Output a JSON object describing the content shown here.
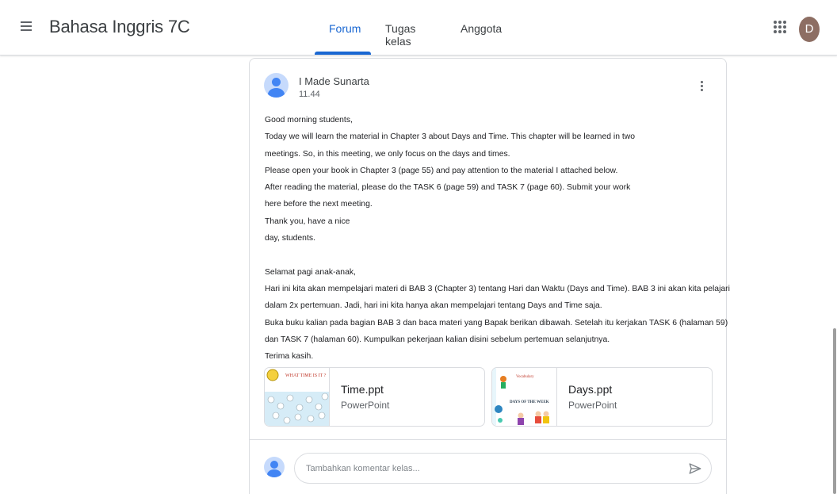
{
  "header": {
    "class_title": "Bahasa Inggris 7C",
    "tabs": [
      {
        "label": "Forum",
        "active": true
      },
      {
        "label": "Tugas kelas",
        "active": false
      },
      {
        "label": "Anggota",
        "active": false
      }
    ],
    "user_initial": "D",
    "accent_color": "#1967d2",
    "avatar_color": "#8d6e63",
    "icons": [
      "menu-icon",
      "apps-grid-icon"
    ]
  },
  "post": {
    "author": "I Made Sunarta",
    "time": "11.44",
    "lines": [
      "Good morning students,",
      "Today we will learn the material in Chapter 3 about Days and Time. This chapter will be learned in two",
      "meetings. So, in this meeting, we only focus on the days and times.",
      "Please open your book in Chapter 3 (page 55) and pay attention to the material I attached below.",
      "After reading the material, please do the TASK 6 (page 59) and TASK 7 (page 60). Submit your work",
      "here before the next meeting.",
      "Thank you, have a nice",
      "day, students.",
      "",
      "Selamat pagi anak-anak,",
      "Hari ini kita akan mempelajari materi di BAB 3 (Chapter 3) tentang Hari dan Waktu (Days and Time). BAB 3 ini akan kita pelajari",
      "dalam 2x pertemuan. Jadi, hari ini kita hanya akan mempelajari tentang Days and Time saja.",
      "Buka buku kalian pada bagian BAB 3 dan baca materi yang Bapak berikan dibawah. Setelah itu kerjakan TASK 6 (halaman 59)",
      "dan TASK 7 (halaman 60). Kumpulkan pekerjaan kalian disini sebelum pertemuan selanjutnya.",
      "Terima kasih."
    ],
    "attachments": [
      {
        "title": "Time.ppt",
        "type": "PowerPoint",
        "thumb_text": "WHAT TIME IS IT ?"
      },
      {
        "title": "Days.ppt",
        "type": "PowerPoint",
        "thumb_text_top": "Vocabulary",
        "thumb_text_mid": "DAYS OF THE WEEK"
      }
    ],
    "icons": [
      "more-vert-icon"
    ]
  },
  "comment": {
    "placeholder": "Tambahkan komentar kelas...",
    "icons": [
      "send-icon"
    ]
  }
}
